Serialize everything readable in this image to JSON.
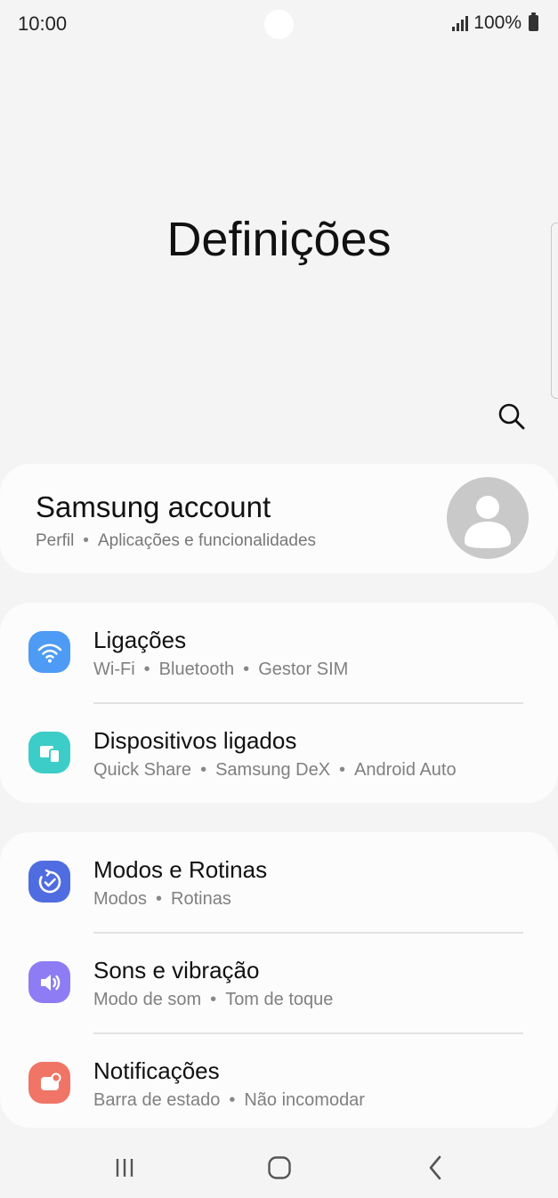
{
  "status_bar": {
    "time": "10:00",
    "battery_text": "100%",
    "icons": [
      "signal-icon",
      "battery-icon"
    ]
  },
  "header": {
    "title": "Definições",
    "search_icon": "search-icon"
  },
  "account": {
    "title": "Samsung account",
    "subtitle_parts": [
      "Perfil",
      "Aplicações e funcionalidades"
    ],
    "avatar_icon": "person-icon"
  },
  "groups": [
    {
      "items": [
        {
          "title": "Ligações",
          "subtitle_parts": [
            "Wi-Fi",
            "Bluetooth",
            "Gestor SIM"
          ],
          "icon": "wifi-icon",
          "color": "#4d9bf5"
        },
        {
          "title": "Dispositivos ligados",
          "subtitle_parts": [
            "Quick Share",
            "Samsung DeX",
            "Android Auto"
          ],
          "icon": "connected-devices-icon",
          "color": "#3ccdc8"
        }
      ]
    },
    {
      "items": [
        {
          "title": "Modos e Rotinas",
          "subtitle_parts": [
            "Modos",
            "Rotinas"
          ],
          "icon": "modes-routines-icon",
          "color": "#4f6de0"
        },
        {
          "title": "Sons e vibração",
          "subtitle_parts": [
            "Modo de som",
            "Tom de toque"
          ],
          "icon": "volume-icon",
          "color": "#8d7cf3"
        },
        {
          "title": "Notificações",
          "subtitle_parts": [
            "Barra de estado",
            "Não incomodar"
          ],
          "icon": "notifications-icon",
          "color": "#f07566"
        }
      ]
    }
  ],
  "nav_bar": {
    "buttons": [
      "recent-apps-icon",
      "home-icon",
      "back-icon"
    ]
  }
}
